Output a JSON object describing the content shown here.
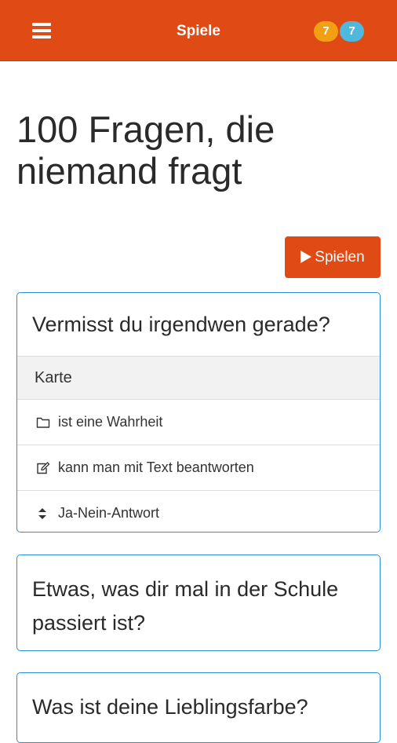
{
  "header": {
    "title": "Spiele",
    "badge_orange": "7",
    "badge_blue": "7"
  },
  "page_title": "100 Fragen, die niemand fragt",
  "play_button_label": "Spielen",
  "cards": [
    {
      "question": "Vermisst du irgendwen gerade?",
      "header": "Karte",
      "rows": [
        {
          "icon": "folder-icon",
          "label": "ist eine Wahrheit"
        },
        {
          "icon": "edit-icon",
          "label": "kann man mit Text beantworten"
        },
        {
          "icon": "sort-icon",
          "label": "Ja-Nein-Antwort"
        }
      ]
    },
    {
      "question": "Etwas, was dir mal in der Schule passiert ist?"
    },
    {
      "question": "Was ist deine Lieblingsfarbe?"
    }
  ],
  "colors": {
    "accent": "#e04a15",
    "badge_orange": "#f0a012",
    "badge_blue": "#4fb8dc",
    "card_border": "#2a8fd8"
  }
}
